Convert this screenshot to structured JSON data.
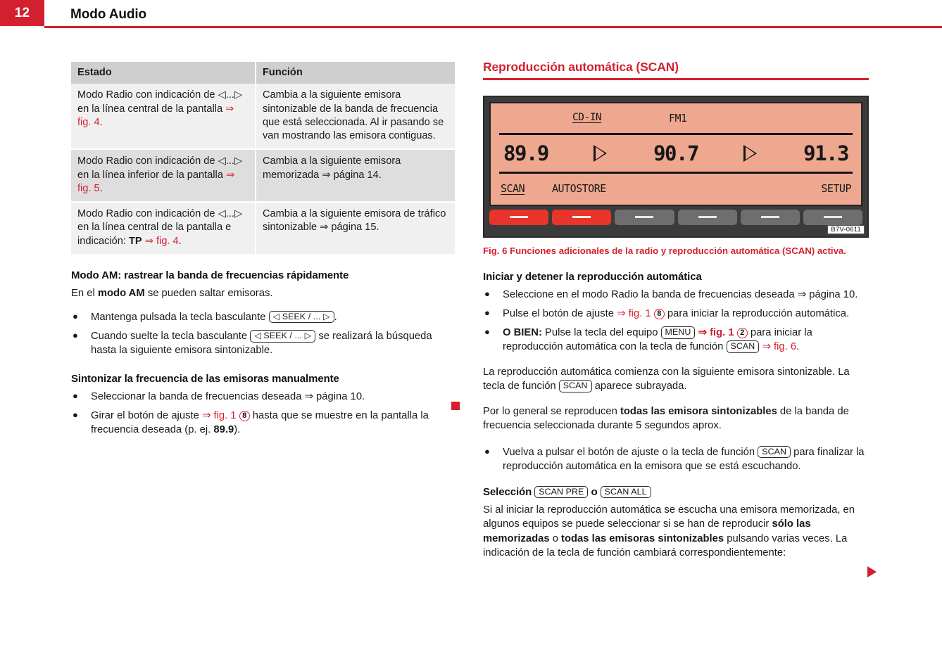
{
  "header": {
    "page_number": "12",
    "title": "Modo Audio",
    "accent_color": "#d4202e"
  },
  "left_column": {
    "table": {
      "headers": [
        "Estado",
        "Función"
      ],
      "rows": [
        {
          "estado_pre": "Modo Radio con indicación de ◁...▷ en la línea central de la pantalla ",
          "estado_ref": "⇒ fig. 4",
          "estado_post": ".",
          "funcion": "Cambia a la siguiente emisora sintonizable de la banda de frecuencia que está seleccionada. Al ir pasando se van mostrando las emisora contiguas."
        },
        {
          "estado_pre": "Modo Radio con indicación de ◁...▷ en la línea inferior de la pantalla ",
          "estado_ref": "⇒ fig. 5",
          "estado_post": ".",
          "funcion": "Cambia a la siguiente emisora memorizada ⇒ página 14."
        },
        {
          "estado_pre": "Modo Radio con indicación de ◁...▷ en la línea central de la pantalla e indicación: ",
          "estado_bold": "TP",
          "estado_ref": "⇒ fig. 4",
          "estado_post": ".",
          "funcion": "Cambia a la siguiente emisora de tráfico sintonizable ⇒ página 15."
        }
      ]
    },
    "heading_am": "Modo AM: rastrear la banda de frecuencias rápidamente",
    "para_am_pre": "En el ",
    "para_am_bold": "modo AM",
    "para_am_post": " se pueden saltar emisoras.",
    "bullets_am": [
      {
        "pre": "Mantenga pulsada la tecla basculante ",
        "key": "◁ SEEK / ... ▷",
        "post": "."
      },
      {
        "pre": "Cuando suelte la tecla basculante ",
        "key": "◁ SEEK / ... ▷",
        "post": " se realizará la búsqueda hasta la siguiente emisora sintonizable."
      }
    ],
    "heading_manual": "Sintonizar la frecuencia de las emisoras manualmente",
    "bullets_manual": [
      {
        "text": "Seleccionar la banda de frecuencias deseada ⇒ página 10."
      },
      {
        "pre": "Girar el botón de ajuste ",
        "ref": "⇒ fig. 1",
        "circle": "8",
        "mid": " hasta que se muestre en la pantalla la frecuencia deseada (p. ej. ",
        "bold": "89.9",
        "post": ")."
      }
    ]
  },
  "right_column": {
    "section_title": "Reproducción automática (SCAN)",
    "radio_display": {
      "source_label": "CD-IN",
      "band_label": "FM1",
      "frequencies": [
        "89.9",
        "90.7",
        "91.3"
      ],
      "function_keys": [
        "SCAN",
        "AUTOSTORE",
        "SETUP"
      ],
      "buttons": [
        "red",
        "red",
        "gray",
        "gray",
        "gray",
        "gray"
      ],
      "figure_code": "B7V-0611",
      "screen_color": "#eda88f",
      "button_red": "#e8342a",
      "button_gray": "#6e6e6e"
    },
    "fig_caption": "Fig. 6  Funciones adicionales de la radio y reproducción automática (SCAN) activa.",
    "heading_start_stop": "Iniciar y detener la reproducción automática",
    "bullets_start": [
      {
        "text": "Seleccione en el modo Radio la banda de frecuencias deseada ⇒ página 10."
      },
      {
        "pre": "Pulse el botón de ajuste ",
        "ref": "⇒ fig. 1",
        "circle": "8",
        "post": " para iniciar la reproducción automática."
      },
      {
        "bold_lead": "O BIEN:",
        "pre": " Pulse la tecla del equipo ",
        "key1": "MENU",
        "ref1": "⇒ fig. 1",
        "circle": "2",
        "mid": " para iniciar la reproducción automática con la tecla de función ",
        "key2": "SCAN",
        "ref2": "⇒ fig. 6",
        "post": "."
      }
    ],
    "para_begins_pre": "La reproducción automática comienza con la siguiente emisora sintonizable. La tecla de función ",
    "para_begins_key": "SCAN",
    "para_begins_post": " aparece subrayada.",
    "para_general_pre": "Por lo general se reproducen ",
    "para_general_bold": "todas las emisora sintonizables",
    "para_general_post": " de la banda de frecuencia seleccionada durante 5 segundos aprox.",
    "bullet_stop": {
      "pre": "Vuelva a pulsar el botón de ajuste o la tecla de función ",
      "key": "SCAN",
      "post": " para finalizar la reproducción automática en la emisora que se está escuchando."
    },
    "selection_heading": {
      "label": "Selección",
      "key1": "SCAN PRE",
      "conj": "o",
      "key2": "SCAN ALL"
    },
    "para_selection_pre": "Si al iniciar la reproducción automática se escucha una emisora memorizada, en algunos equipos se puede seleccionar si se han de reproducir ",
    "para_selection_bold1": "sólo las memorizadas",
    "para_selection_mid": " o ",
    "para_selection_bold2": "todas las emisoras sintonizables",
    "para_selection_post": " pulsando varias veces. La indicación de la tecla de función cambiará correspondientemente:"
  }
}
